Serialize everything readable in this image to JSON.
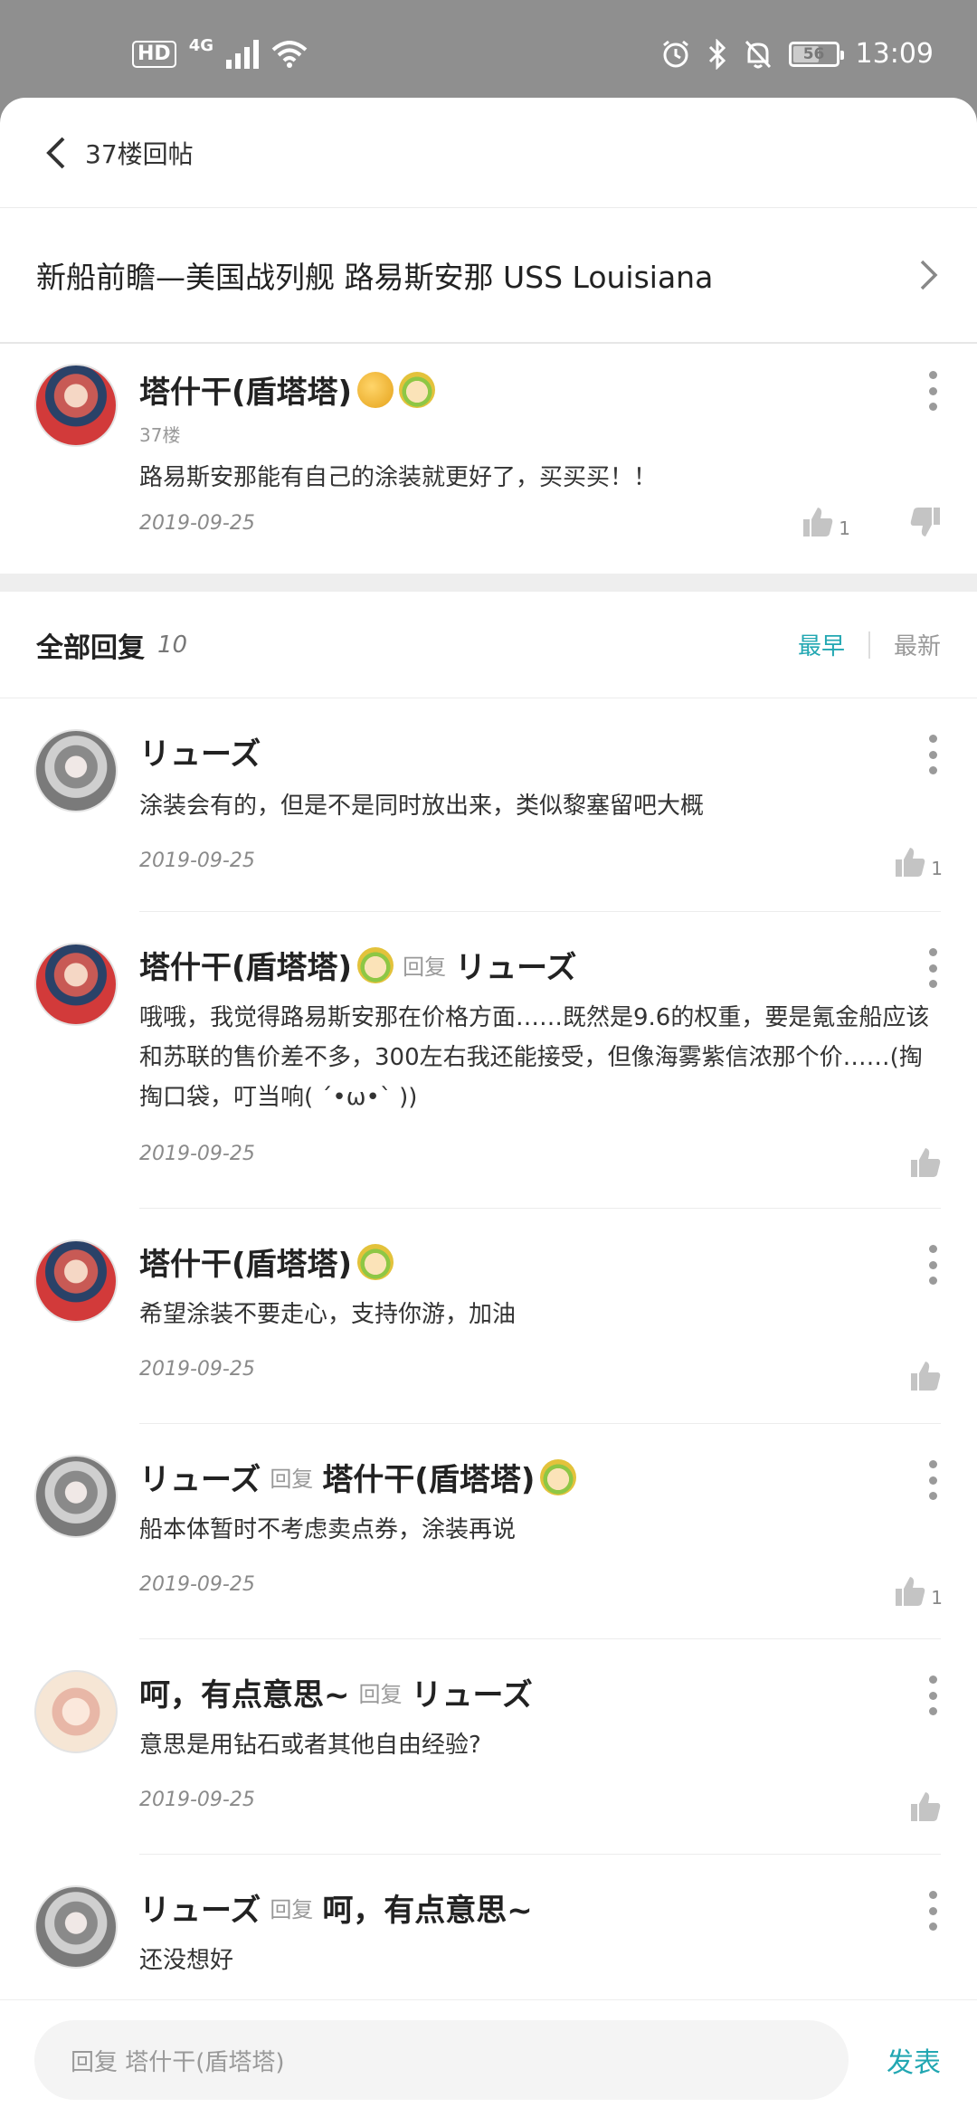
{
  "status": {
    "hd": "HD",
    "network": "4G",
    "battery": "56",
    "time": "13:09"
  },
  "header": {
    "title": "37楼回帖"
  },
  "thread": {
    "title": "新船前瞻—美国战列舰 路易斯安那 USS Louisiana"
  },
  "main_post": {
    "user": "塔什干(盾塔塔)",
    "floor": "37楼",
    "text": "路易斯安那能有自己的涂装就更好了，买买买！！",
    "date": "2019-09-25",
    "likes": "1"
  },
  "replies_header": {
    "label": "全部回复",
    "count": "10",
    "sort_earliest": "最早",
    "sort_latest": "最新"
  },
  "replies": [
    {
      "user": "リューズ",
      "reply_word": "",
      "reply_to": "",
      "text": "涂装会有的，但是不是同时放出来，类似黎塞留吧大概",
      "date": "2019-09-25",
      "likes": "1"
    },
    {
      "user": "塔什干(盾塔塔)",
      "reply_word": "回复",
      "reply_to": "リューズ",
      "text": "哦哦，我觉得路易斯安那在价格方面……既然是9.6的权重，要是氪金船应该和苏联的售价差不多，300左右我还能接受，但像海雾紫信浓那个价……(掏掏口袋，叮当响( ´•ω•` ))",
      "date": "2019-09-25",
      "likes": ""
    },
    {
      "user": "塔什干(盾塔塔)",
      "reply_word": "",
      "reply_to": "",
      "text": "希望涂装不要走心，支持你游，加油",
      "date": "2019-09-25",
      "likes": ""
    },
    {
      "user": "リューズ",
      "reply_word": "回复",
      "reply_to": "塔什干(盾塔塔)",
      "text": "船本体暂时不考虑卖点券，涂装再说",
      "date": "2019-09-25",
      "likes": "1"
    },
    {
      "user": "呵，有点意思~",
      "reply_word": "回复",
      "reply_to": "リューズ",
      "text": "意思是用钻石或者其他自由经验?",
      "date": "2019-09-25",
      "likes": ""
    },
    {
      "user": "リューズ",
      "reply_word": "回复",
      "reply_to": "呵，有点意思~",
      "text": "还没想好",
      "date": "",
      "likes": ""
    }
  ],
  "composer": {
    "placeholder": "回复 塔什干(盾塔塔)",
    "send_label": "发表"
  }
}
